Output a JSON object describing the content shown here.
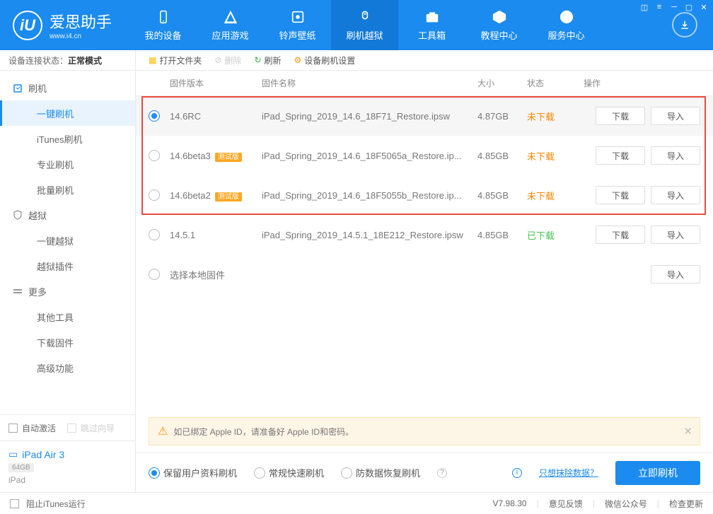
{
  "logo": {
    "letter": "iU",
    "title": "爱思助手",
    "sub": "www.i4.cn"
  },
  "nav": [
    {
      "label": "我的设备"
    },
    {
      "label": "应用游戏"
    },
    {
      "label": "铃声壁纸"
    },
    {
      "label": "刷机越狱",
      "active": true
    },
    {
      "label": "工具箱"
    },
    {
      "label": "教程中心"
    },
    {
      "label": "服务中心"
    }
  ],
  "status": {
    "label": "设备连接状态：",
    "value": "正常模式"
  },
  "sidebar": {
    "groups": [
      {
        "label": "刷机",
        "items": [
          "一键刷机",
          "iTunes刷机",
          "专业刷机",
          "批量刷机"
        ],
        "active": 0
      },
      {
        "label": "越狱",
        "items": [
          "一键越狱",
          "越狱插件"
        ]
      },
      {
        "label": "更多",
        "items": [
          "其他工具",
          "下载固件",
          "高级功能"
        ]
      }
    ],
    "auto_activate": "自动激活",
    "skip_guide": "跳过向导"
  },
  "device": {
    "name": "iPad Air 3",
    "cap": "64GB",
    "type": "iPad"
  },
  "toolbar": {
    "open": "打开文件夹",
    "delete": "删除",
    "refresh": "刷新",
    "settings": "设备刷机设置"
  },
  "cols": {
    "ver": "固件版本",
    "name": "固件名称",
    "size": "大小",
    "status": "状态",
    "ops": "操作"
  },
  "rows": [
    {
      "ver": "14.6RC",
      "name": "iPad_Spring_2019_14.6_18F71_Restore.ipsw",
      "size": "4.87GB",
      "status": "未下载",
      "st": "r",
      "sel": true,
      "badge": false,
      "btns": [
        "下载",
        "导入"
      ]
    },
    {
      "ver": "14.6beta3",
      "name": "iPad_Spring_2019_14.6_18F5065a_Restore.ip...",
      "size": "4.85GB",
      "status": "未下载",
      "st": "r",
      "badge": true,
      "btns": [
        "下载",
        "导入"
      ]
    },
    {
      "ver": "14.6beta2",
      "name": "iPad_Spring_2019_14.6_18F5055b_Restore.ip...",
      "size": "4.85GB",
      "status": "未下载",
      "st": "r",
      "badge": true,
      "btns": [
        "下载",
        "导入"
      ]
    },
    {
      "ver": "14.5.1",
      "name": "iPad_Spring_2019_14.5.1_18E212_Restore.ipsw",
      "size": "4.85GB",
      "status": "已下载",
      "st": "g",
      "btns": [
        "下载",
        "导入"
      ]
    },
    {
      "ver": "选择本地固件",
      "name": "",
      "size": "",
      "status": "",
      "btns": [
        "导入"
      ]
    }
  ],
  "badge_text": "测试版",
  "tip": "如已绑定 Apple ID，请准备好 Apple ID和密码。",
  "modes": [
    "保留用户资料刷机",
    "常规快速刷机",
    "防数据恢复刷机"
  ],
  "mode_link": "只想抹除数据？",
  "flash": "立即刷机",
  "footer": {
    "block": "阻止iTunes运行",
    "ver": "V7.98.30",
    "feedback": "意见反馈",
    "wechat": "微信公众号",
    "update": "检查更新"
  }
}
